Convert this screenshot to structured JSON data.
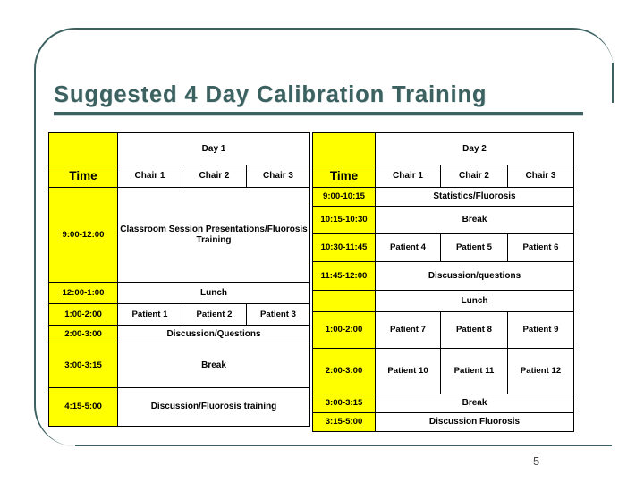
{
  "slide": {
    "title": "Suggested 4 Day Calibration Training",
    "page_number": "5",
    "accent_color": "#3c6160",
    "highlight_color": "#ffff00"
  },
  "day1": {
    "day_label": "Day 1",
    "time_header": "Time",
    "chairs": [
      "Chair 1",
      "Chair 2",
      "Chair 3"
    ],
    "rows": [
      {
        "time": "9:00-12:00",
        "span": true,
        "text": "Classroom Session Presentations/Fluorosis Training"
      },
      {
        "time": "12:00-1:00",
        "span": true,
        "text": "Lunch"
      },
      {
        "time": "1:00-2:00",
        "span": false,
        "cells": [
          "Patient 1",
          "Patient 2",
          "Patient 3"
        ]
      },
      {
        "time": "2:00-3:00",
        "span": true,
        "text": "Discussion/Questions"
      },
      {
        "time": "3:00-3:15",
        "span": true,
        "text": "Break"
      },
      {
        "time": "4:15-5:00",
        "span": true,
        "text": "Discussion/Fluorosis training"
      }
    ]
  },
  "day2": {
    "day_label": "Day 2",
    "time_header": "Time",
    "chairs": [
      "Chair 1",
      "Chair 2",
      "Chair 3"
    ],
    "rows": [
      {
        "time": "9:00-10:15",
        "span": true,
        "text": "Statistics/Fluorosis"
      },
      {
        "time": "10:15-10:30",
        "span": true,
        "text": "Break"
      },
      {
        "time": "10:30-11:45",
        "span": false,
        "cells": [
          "Patient 4",
          "Patient 5",
          "Patient 6"
        ]
      },
      {
        "time": "11:45-12:00",
        "span": true,
        "text": "Discussion/questions"
      },
      {
        "time": "",
        "span": true,
        "text": "Lunch"
      },
      {
        "time": "1:00-2:00",
        "span": false,
        "cells": [
          "Patient 7",
          "Patient 8",
          "Patient 9"
        ]
      },
      {
        "time": "2:00-3:00",
        "span": false,
        "cells": [
          "Patient 10",
          "Patient 11",
          "Patient 12"
        ]
      },
      {
        "time": "3:00-3:15",
        "span": true,
        "text": "Break"
      },
      {
        "time": "3:15-5:00",
        "span": true,
        "text": "Discussion Fluorosis"
      }
    ]
  }
}
